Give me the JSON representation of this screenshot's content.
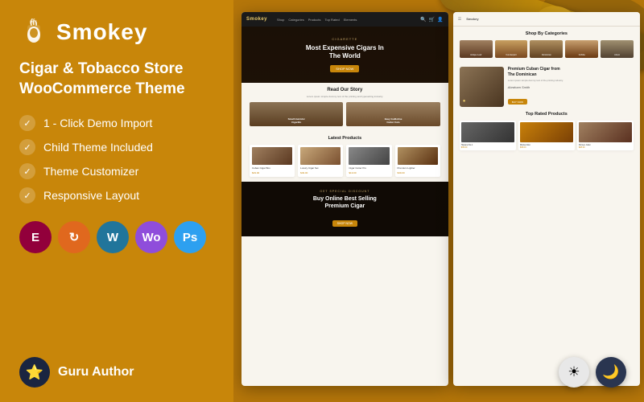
{
  "logo": {
    "title": "Smokey",
    "icon": "🪨"
  },
  "tagline": "Cigar & Tobacco Store\nWooCommerce Theme",
  "features": [
    {
      "id": "demo-import",
      "text": "1 - Click Demo Import"
    },
    {
      "id": "child-theme",
      "text": "Child Theme Included"
    },
    {
      "id": "customizer",
      "text": "Theme Customizer"
    },
    {
      "id": "responsive",
      "text": "Responsive Layout"
    }
  ],
  "tech_icons": [
    {
      "id": "elementor",
      "label": "E",
      "bg": "#92003b"
    },
    {
      "id": "customizer2",
      "label": "↻",
      "bg": "#e0681e"
    },
    {
      "id": "wordpress",
      "label": "W",
      "bg": "#21759b"
    },
    {
      "id": "woocommerce",
      "label": "Wo",
      "bg": "#8f4ddb"
    },
    {
      "id": "photoshop",
      "label": "Ps",
      "bg": "#2da0f0"
    }
  ],
  "guru": {
    "label": "Guru Author",
    "badge": "⭐"
  },
  "preview_left": {
    "nav": {
      "logo": "Smokey",
      "links": [
        "Shop",
        "Categories",
        "Products",
        "Top Rated",
        "Elements"
      ]
    },
    "hero": {
      "subtitle": "CIGARETTE",
      "title": "Most Expensive Cigars In\nThe World",
      "btn": "SHOP NOW"
    },
    "story": {
      "title": "Read Our Story",
      "desc": "Lorem ipsum simple dummy text of the printing and typesetting industry.",
      "cards": [
        {
          "label": "Small Humidor\nCigarillo"
        },
        {
          "label": "Easy Guillotine\nCutter Cuts"
        }
      ]
    },
    "products": {
      "title": "Latest Products",
      "items": [
        {
          "name": "Cuban Cigar Box",
          "price": "$29.00"
        },
        {
          "name": "Luxury Cigar Set",
          "price": "$49.00"
        },
        {
          "name": "Cigar Cutter Pro",
          "price": "$19.00"
        },
        {
          "name": "Premium Lighter",
          "price": "$39.00"
        }
      ]
    },
    "promo": {
      "label": "GET SPECIAL DISCOUNT",
      "title": "Buy Online Best Selling\nPremium Cigar",
      "btn": "SHOP NOW"
    }
  },
  "preview_right": {
    "categories": {
      "title": "Shop By Categories",
      "items": [
        {
          "label": "Antique Leaf"
        },
        {
          "label": "Counterpart"
        },
        {
          "label": "Dominican"
        },
        {
          "label": "Cohiba"
        },
        {
          "label": "Arturo"
        }
      ]
    },
    "featured": {
      "title": "Premium Cuban Cigar from\nThe Dominican",
      "desc": "Lorem ipsum simple dummy text of the printing industry.",
      "btn": "BUY NOW",
      "signature": "Abraham Smith"
    },
    "top_rated": {
      "title": "Top Rated Products",
      "items": [
        {
          "name": "Havana No.1",
          "price": "$35.00"
        },
        {
          "name": "Montecristo",
          "price": "$45.00"
        },
        {
          "name": "Romeo Juliet",
          "price": "$28.00"
        }
      ]
    }
  },
  "dark_toggle": {
    "light_icon": "☀",
    "dark_icon": "🌙"
  },
  "colors": {
    "accent": "#c8860a",
    "dark_bg": "#1a1a1a",
    "light_bg": "#f8f5ee"
  }
}
